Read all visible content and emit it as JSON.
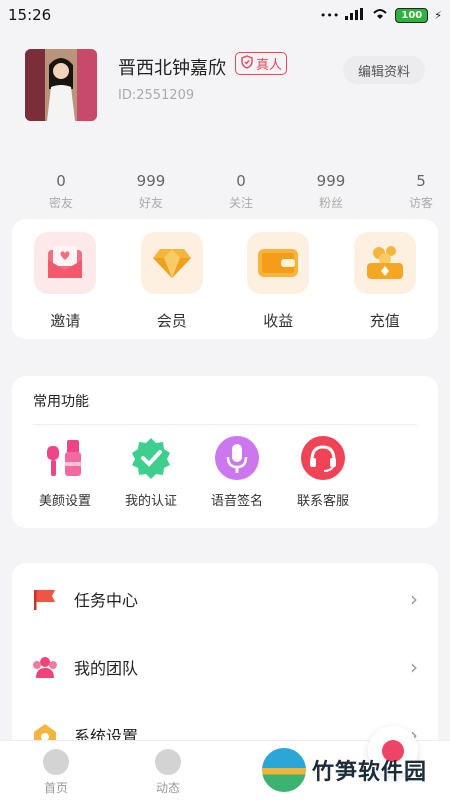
{
  "status_bar": {
    "time": "15:26",
    "signal": "HD",
    "battery": "100"
  },
  "profile": {
    "name": "晋西北钟嘉欣",
    "verified_label": "真人",
    "id_text": "ID:2551209",
    "edit_button": "编辑资料"
  },
  "stats": [
    {
      "value": "0",
      "label": "密友"
    },
    {
      "value": "999",
      "label": "好友"
    },
    {
      "value": "0",
      "label": "关注"
    },
    {
      "value": "999",
      "label": "粉丝"
    },
    {
      "value": "5",
      "label": "访客"
    }
  ],
  "main_features": [
    {
      "label": "邀请",
      "icon": "envelope-heart-icon",
      "color": "#f07080"
    },
    {
      "label": "会员",
      "icon": "diamond-icon",
      "color": "#f5b53d"
    },
    {
      "label": "收益",
      "icon": "wallet-icon",
      "color": "#f5a623"
    },
    {
      "label": "充值",
      "icon": "coin-box-icon",
      "color": "#f5a623"
    }
  ],
  "common": {
    "title": "常用功能",
    "items": [
      {
        "label": "美颜设置",
        "icon": "makeup-icon",
        "color": "#ee4488"
      },
      {
        "label": "我的认证",
        "icon": "badge-check-icon",
        "color": "#3ecf8e"
      },
      {
        "label": "语音签名",
        "icon": "microphone-icon",
        "color": "#cc77ee"
      },
      {
        "label": "联系客服",
        "icon": "headset-icon",
        "color": "#ee4455"
      }
    ]
  },
  "list": [
    {
      "label": "任务中心",
      "icon": "flag-icon",
      "color": "#ee5544"
    },
    {
      "label": "我的团队",
      "icon": "team-icon",
      "color": "#ee4477"
    },
    {
      "label": "系统设置",
      "icon": "settings-house-icon",
      "color": "#f5b53d"
    }
  ],
  "tabs": [
    {
      "label": "首页"
    },
    {
      "label": "动态"
    }
  ],
  "watermark": {
    "text": "竹笋软件园"
  }
}
